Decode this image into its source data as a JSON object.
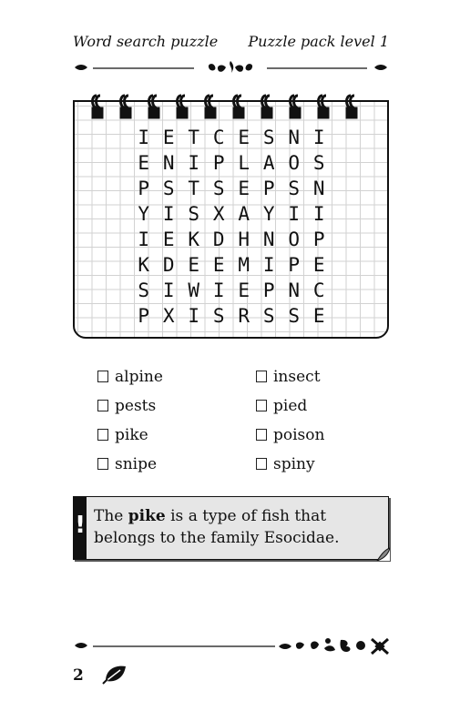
{
  "header": {
    "title": "Word search puzzle",
    "level": "Puzzle pack level 1"
  },
  "grid": [
    [
      "I",
      "E",
      "T",
      "C",
      "E",
      "S",
      "N",
      "I"
    ],
    [
      "E",
      "N",
      "I",
      "P",
      "L",
      "A",
      "O",
      "S"
    ],
    [
      "P",
      "S",
      "T",
      "S",
      "E",
      "P",
      "S",
      "N"
    ],
    [
      "Y",
      "I",
      "S",
      "X",
      "A",
      "Y",
      "I",
      "I"
    ],
    [
      "I",
      "E",
      "K",
      "D",
      "H",
      "N",
      "O",
      "P"
    ],
    [
      "K",
      "D",
      "E",
      "E",
      "M",
      "I",
      "P",
      "E"
    ],
    [
      "S",
      "I",
      "W",
      "I",
      "E",
      "P",
      "N",
      "C"
    ],
    [
      "P",
      "X",
      "I",
      "S",
      "R",
      "S",
      "S",
      "E"
    ]
  ],
  "words": {
    "left": [
      "alpine",
      "pests",
      "pike",
      "snipe"
    ],
    "right": [
      "insect",
      "pied",
      "poison",
      "spiny"
    ]
  },
  "note": {
    "icon": "!",
    "before": "The ",
    "bold": "pike",
    "after": " is a type of fish that belongs to the family Esocidae."
  },
  "footer": {
    "page_number": "2",
    "icon": "leaf-icon"
  }
}
